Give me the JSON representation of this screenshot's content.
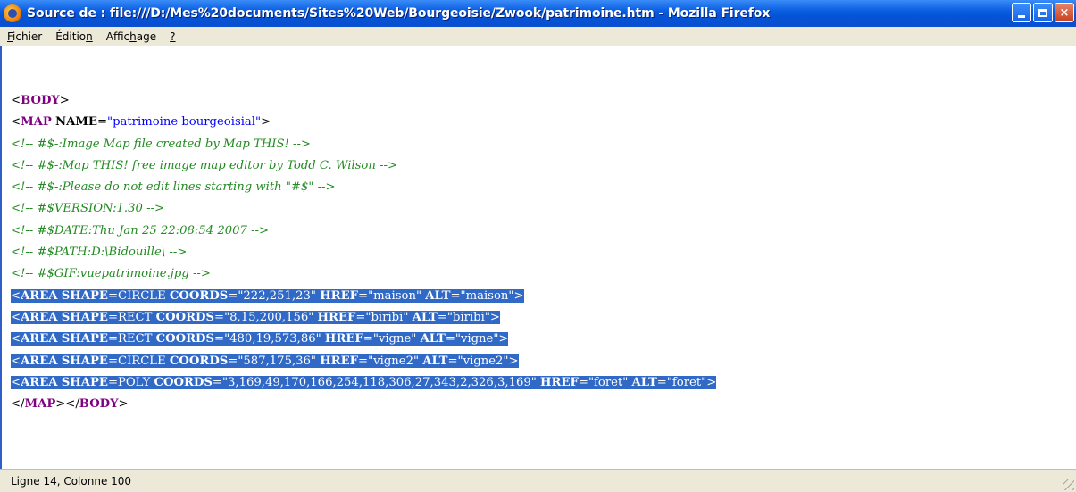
{
  "window": {
    "title": "Source de : file:///D:/Mes%20documents/Sites%20Web/Bourgeoisie/Zwook/patrimoine.htm - Mozilla Firefox",
    "app_icon": "firefox-icon",
    "buttons": {
      "minimize": "minimize",
      "maximize": "maximize",
      "close": "×"
    }
  },
  "menu": {
    "items": [
      {
        "label": "Fichier",
        "accel": "F",
        "rest": "ichier"
      },
      {
        "label": "Édition",
        "pre": "Éditio",
        "accel": "n"
      },
      {
        "label": "Affichage",
        "pre": "Affic",
        "accel": "h",
        "post": "age"
      },
      {
        "label": "?",
        "accel": "?"
      }
    ]
  },
  "source": {
    "lines": [
      {
        "kind": "plain",
        "parts": [
          [
            "tag",
            "<"
          ],
          [
            "tagname",
            "BODY"
          ],
          [
            "tag",
            ">"
          ]
        ]
      },
      {
        "kind": "plain",
        "parts": [
          [
            "tag",
            "<"
          ],
          [
            "tagname",
            "MAP"
          ],
          [
            "tag",
            " "
          ],
          [
            "attr",
            "NAME"
          ],
          [
            "tag",
            "="
          ],
          [
            "val",
            "\"patrimoine bourgeoisial\""
          ],
          [
            "tag",
            ">"
          ]
        ]
      },
      {
        "kind": "plain",
        "parts": [
          [
            "cm",
            "<!-- #$-:Image Map file created by Map THIS! -->"
          ]
        ]
      },
      {
        "kind": "plain",
        "parts": [
          [
            "cm",
            "<!-- #$-:Map THIS! free image map editor by Todd C. Wilson -->"
          ]
        ]
      },
      {
        "kind": "plain",
        "parts": [
          [
            "cm",
            "<!-- #$-:Please do not edit lines starting with \"#$\" -->"
          ]
        ]
      },
      {
        "kind": "plain",
        "parts": [
          [
            "cm",
            "<!-- #$VERSION:1.30 -->"
          ]
        ]
      },
      {
        "kind": "plain",
        "parts": [
          [
            "cm",
            "<!-- #$DATE:Thu Jan 25 22:08:54 2007 -->"
          ]
        ]
      },
      {
        "kind": "plain",
        "parts": [
          [
            "cm",
            "<!-- #$PATH:D:\\Bidouille\\ -->"
          ]
        ]
      },
      {
        "kind": "plain",
        "parts": [
          [
            "cm",
            "<!-- #$GIF:vuepatrimoine.jpg -->"
          ]
        ]
      },
      {
        "kind": "sel",
        "parts": [
          [
            "tag",
            "<"
          ],
          [
            "tagname",
            "AREA"
          ],
          [
            "tag",
            " "
          ],
          [
            "attr",
            "SHAPE"
          ],
          [
            "tag",
            "=CIRCLE "
          ],
          [
            "attr",
            "COORDS"
          ],
          [
            "tag",
            "="
          ],
          [
            "val",
            "\"222,251,23\""
          ],
          [
            "tag",
            " "
          ],
          [
            "attr",
            "HREF"
          ],
          [
            "tag",
            "="
          ],
          [
            "val",
            "\"maison\""
          ],
          [
            "tag",
            " "
          ],
          [
            "attr",
            "ALT"
          ],
          [
            "tag",
            "="
          ],
          [
            "val",
            "\"maison\""
          ],
          [
            "tag",
            ">"
          ]
        ]
      },
      {
        "kind": "sel",
        "parts": [
          [
            "tag",
            "<"
          ],
          [
            "tagname",
            "AREA"
          ],
          [
            "tag",
            " "
          ],
          [
            "attr",
            "SHAPE"
          ],
          [
            "tag",
            "=RECT "
          ],
          [
            "attr",
            "COORDS"
          ],
          [
            "tag",
            "="
          ],
          [
            "val",
            "\"8,15,200,156\""
          ],
          [
            "tag",
            " "
          ],
          [
            "attr",
            "HREF"
          ],
          [
            "tag",
            "="
          ],
          [
            "val",
            "\"biribi\""
          ],
          [
            "tag",
            " "
          ],
          [
            "attr",
            "ALT"
          ],
          [
            "tag",
            "="
          ],
          [
            "val",
            "\"biribi\""
          ],
          [
            "tag",
            ">"
          ]
        ]
      },
      {
        "kind": "sel",
        "parts": [
          [
            "tag",
            "<"
          ],
          [
            "tagname",
            "AREA"
          ],
          [
            "tag",
            " "
          ],
          [
            "attr",
            "SHAPE"
          ],
          [
            "tag",
            "=RECT "
          ],
          [
            "attr",
            "COORDS"
          ],
          [
            "tag",
            "="
          ],
          [
            "val",
            "\"480,19,573,86\""
          ],
          [
            "tag",
            " "
          ],
          [
            "attr",
            "HREF"
          ],
          [
            "tag",
            "="
          ],
          [
            "val",
            "\"vigne\""
          ],
          [
            "tag",
            " "
          ],
          [
            "attr",
            "ALT"
          ],
          [
            "tag",
            "="
          ],
          [
            "val",
            "\"vigne\""
          ],
          [
            "tag",
            ">"
          ]
        ]
      },
      {
        "kind": "sel",
        "parts": [
          [
            "tag",
            "<"
          ],
          [
            "tagname",
            "AREA"
          ],
          [
            "tag",
            " "
          ],
          [
            "attr",
            "SHAPE"
          ],
          [
            "tag",
            "=CIRCLE "
          ],
          [
            "attr",
            "COORDS"
          ],
          [
            "tag",
            "="
          ],
          [
            "val",
            "\"587,175,36\""
          ],
          [
            "tag",
            " "
          ],
          [
            "attr",
            "HREF"
          ],
          [
            "tag",
            "="
          ],
          [
            "val",
            "\"vigne2\""
          ],
          [
            "tag",
            " "
          ],
          [
            "attr",
            "ALT"
          ],
          [
            "tag",
            "="
          ],
          [
            "val",
            "\"vigne2\""
          ],
          [
            "tag",
            ">"
          ]
        ]
      },
      {
        "kind": "sel",
        "parts": [
          [
            "tag",
            "<"
          ],
          [
            "tagname",
            "AREA"
          ],
          [
            "tag",
            " "
          ],
          [
            "attr",
            "SHAPE"
          ],
          [
            "tag",
            "=POLY "
          ],
          [
            "attr",
            "COORDS"
          ],
          [
            "tag",
            "="
          ],
          [
            "val",
            "\"3,169,49,170,166,254,118,306,27,343,2,326,3,169\""
          ],
          [
            "tag",
            " "
          ],
          [
            "attr",
            "HREF"
          ],
          [
            "tag",
            "="
          ],
          [
            "val",
            "\"foret\""
          ],
          [
            "tag",
            " "
          ],
          [
            "attr",
            "ALT"
          ],
          [
            "tag",
            "="
          ],
          [
            "val",
            "\"foret\""
          ],
          [
            "tag",
            ">"
          ]
        ]
      },
      {
        "kind": "plain",
        "parts": [
          [
            "tag",
            "</"
          ],
          [
            "tagname",
            "MAP"
          ],
          [
            "tag",
            "></"
          ],
          [
            "tagname",
            "BODY"
          ],
          [
            "tag",
            ">"
          ]
        ]
      }
    ]
  },
  "status": {
    "text": "Ligne 14, Colonne 100"
  },
  "colors": {
    "selection": "#3169c6",
    "tagname": "#800080",
    "value": "#0000ff",
    "comment": "#228b22"
  }
}
